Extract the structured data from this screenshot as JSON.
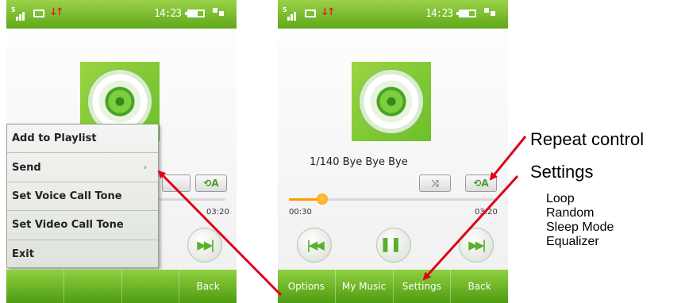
{
  "left_phone": {
    "status": {
      "time": "14:23",
      "signal_label": "5"
    },
    "context_menu": {
      "items": [
        {
          "label": "Add to Playlist",
          "has_submenu": false
        },
        {
          "label": "Send",
          "has_submenu": true
        },
        {
          "label": "Set Voice Call Tone",
          "has_submenu": false
        },
        {
          "label": "Set Video Call Tone",
          "has_submenu": false
        },
        {
          "label": "Exit",
          "has_submenu": false
        }
      ]
    },
    "end_time": "03:20",
    "softkeys": {
      "back_label": "Back"
    }
  },
  "right_phone": {
    "status": {
      "time": "14:23",
      "signal_label": "5"
    },
    "track_info": "1/140  Bye Bye Bye",
    "elapsed_time": "00:30",
    "end_time": "03:20",
    "progress": 0.16,
    "softkeys": {
      "options_label": "Options",
      "my_music_label": "My Music",
      "settings_label": "Settings",
      "back_label": "Back"
    }
  },
  "annotations": {
    "repeat_control": "Repeat control",
    "settings": "Settings",
    "settings_items": [
      "Loop",
      "Random",
      "Sleep Mode",
      "Equalizer"
    ]
  },
  "colors": {
    "accent_green": "#6bbf2a",
    "progress_orange": "#ff9900",
    "annotation_arrow": "#e0001a"
  },
  "icons": {
    "shuffle": "shuffle-icon",
    "repeat": "repeat-ab-icon",
    "previous": "skip-previous-icon",
    "pause": "pause-icon",
    "next": "skip-next-icon"
  }
}
